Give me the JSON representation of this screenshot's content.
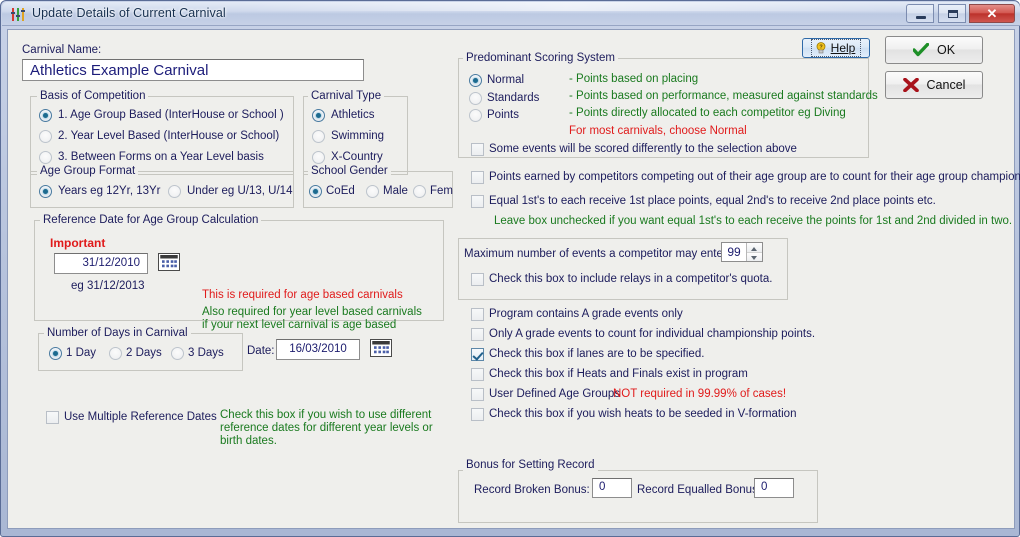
{
  "window": {
    "title": "Update Details of Current Carnival",
    "icon": "sliders-icon",
    "controls": {
      "minimize": "minimize-button",
      "maximize": "maximize-button",
      "close_glyph": "✕"
    }
  },
  "colors": {
    "label_navy": "#1c1c5c",
    "hint_green": "#1a7a1f",
    "warning_red": "#e01b1b",
    "input_text": "#1c1c6e",
    "client_bg": "#efefec"
  },
  "action_buttons": {
    "help": "Help",
    "ok": "OK",
    "cancel": "Cancel"
  },
  "carnival_name": {
    "label": "Carnival Name:",
    "value": "Athletics  Example Carnival",
    "placeholder": ""
  },
  "basis_of_competition": {
    "title": "Basis of Competition",
    "options": [
      {
        "label": "1. Age Group Based  (InterHouse or School )",
        "selected": true
      },
      {
        "label": "2. Year Level Based  (InterHouse or School)",
        "selected": false
      },
      {
        "label": "3. Between Forms on a Year Level basis",
        "selected": false
      }
    ]
  },
  "carnival_type": {
    "title": "Carnival Type",
    "options": [
      {
        "label": "Athletics",
        "selected": true
      },
      {
        "label": "Swimming",
        "selected": false
      },
      {
        "label": "X-Country",
        "selected": false
      }
    ]
  },
  "age_group_format": {
    "title": "Age Group Format",
    "options": [
      {
        "label": "Years eg 12Yr, 13Yr",
        "selected": true
      },
      {
        "label": "Under eg U/13, U/14",
        "selected": false
      }
    ]
  },
  "school_gender": {
    "title": "School Gender",
    "options": [
      {
        "label": "CoEd",
        "selected": true
      },
      {
        "label": "Male",
        "selected": false
      },
      {
        "label": "Fem",
        "selected": false
      }
    ]
  },
  "reference_date": {
    "title": "Reference Date for Age Group Calculation",
    "important_label": "Important",
    "value": "31/12/2010",
    "example": "eg 31/12/2013",
    "hint_red": "This is required for age based carnivals",
    "hint_green_line1": "Also required for year level based carnivals",
    "hint_green_line2": "if your next level carnival is age based",
    "calendar_icon": "calendar-icon"
  },
  "number_of_days": {
    "title": "Number of Days in Carnival",
    "options": [
      {
        "label": "1 Day",
        "selected": true
      },
      {
        "label": "2 Days",
        "selected": false
      },
      {
        "label": "3 Days",
        "selected": false
      }
    ],
    "date_label": "Date:",
    "date_value": "16/03/2010",
    "calendar_icon": "calendar-icon"
  },
  "multiple_reference_dates": {
    "label": "Use Multiple Reference Dates",
    "checked": false,
    "hint_line1": "Check this box if you wish to use different",
    "hint_line2": "reference dates for different year levels or",
    "hint_line3": "birth dates."
  },
  "scoring_system": {
    "title": "Predominant Scoring System",
    "options": [
      {
        "label": "Normal",
        "selected": true,
        "description": "- Points based on placing"
      },
      {
        "label": "Standards",
        "selected": false,
        "description": "- Points based on performance, measured against standards"
      },
      {
        "label": "Points",
        "selected": false,
        "description": "- Points directly allocated to each competitor eg Diving"
      }
    ],
    "advice": "For most carnivals, choose Normal",
    "override_checkbox": {
      "label": "Some events will be scored differently to the selection above",
      "checked": false
    }
  },
  "points_options": [
    {
      "label": "Points earned by competitors competing out of their age group are to count for their age group championship",
      "checked": false
    },
    {
      "label": "Equal 1st's to each receive 1st place points, equal 2nd's to receive 2nd place points etc.",
      "checked": false
    }
  ],
  "points_hint": "Leave box unchecked if you want equal 1st's to each receive the points for 1st and 2nd divided in two.",
  "max_events": {
    "label": "Maximum number of events a competitor may enter:",
    "value": "99",
    "relays_checkbox": {
      "label": "Check this box to include relays in a competitor's quota.",
      "checked": false
    }
  },
  "program_options": [
    {
      "label": "Program contains A grade events only",
      "checked": false,
      "note": ""
    },
    {
      "label": "Only A grade events to count for individual championship points.",
      "checked": false,
      "note": ""
    },
    {
      "label": "Check this box if lanes are to be specified.",
      "checked": true,
      "note": ""
    },
    {
      "label": "Check this box if Heats and Finals exist in program",
      "checked": false,
      "note": ""
    },
    {
      "label": "User Defined Age Groups",
      "checked": false,
      "note": "NOT required in 99.99% of cases!"
    },
    {
      "label": "Check this box if you wish heats to be seeded in V-formation",
      "checked": false,
      "note": ""
    }
  ],
  "bonus": {
    "title": "Bonus for Setting Record",
    "broken_label": "Record Broken Bonus:",
    "broken_value": "0",
    "equalled_label": "Record Equalled Bonus:",
    "equalled_value": "0"
  }
}
